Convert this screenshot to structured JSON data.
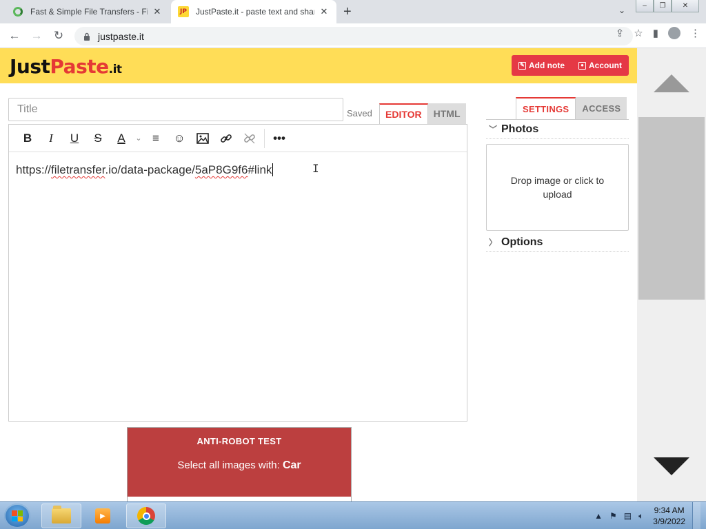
{
  "browser": {
    "tabs": [
      {
        "title": "Fast & Simple File Transfers - File",
        "active": false,
        "favicon": "filetransfer-favicon"
      },
      {
        "title": "JustPaste.it - paste text and share",
        "active": true,
        "favicon": "justpaste-favicon"
      }
    ],
    "new_tab_label": "+",
    "url": "justpaste.it"
  },
  "page": {
    "logo": {
      "part1": "Just",
      "part2": "Paste",
      "part3": ".it"
    },
    "header_buttons": {
      "add_note": "Add note",
      "account": "Account"
    },
    "title_placeholder": "Title",
    "saved_status": "Saved",
    "mode_tabs": {
      "editor": "EDITOR",
      "html": "HTML"
    },
    "toolbar_icons": [
      "bold-icon",
      "italic-icon",
      "underline-icon",
      "strikethrough-icon",
      "text-color-icon",
      "align-icon",
      "emoji-icon",
      "image-icon",
      "link-icon",
      "unlink-icon",
      "more-icon"
    ],
    "editor_content": {
      "part1": "https://",
      "part2": "filetransfer",
      "part3": ".io/data-package/",
      "part4": "5aP8G9f6",
      "part5": "#link"
    },
    "side_tabs": {
      "settings": "SETTINGS",
      "access": "ACCESS"
    },
    "photos": {
      "heading": "Photos",
      "dropzone_text": "Drop image or click to upload"
    },
    "options": {
      "heading": "Options"
    },
    "captcha": {
      "title": "ANTI-ROBOT TEST",
      "prompt": "Select all images with:",
      "target": "Car"
    }
  },
  "taskbar": {
    "clock_time": "9:34 AM",
    "clock_date": "3/9/2022"
  },
  "colors": {
    "header_bg": "#ffdd57",
    "accent_red": "#e53935",
    "captcha_bg": "#bc3f3f"
  }
}
